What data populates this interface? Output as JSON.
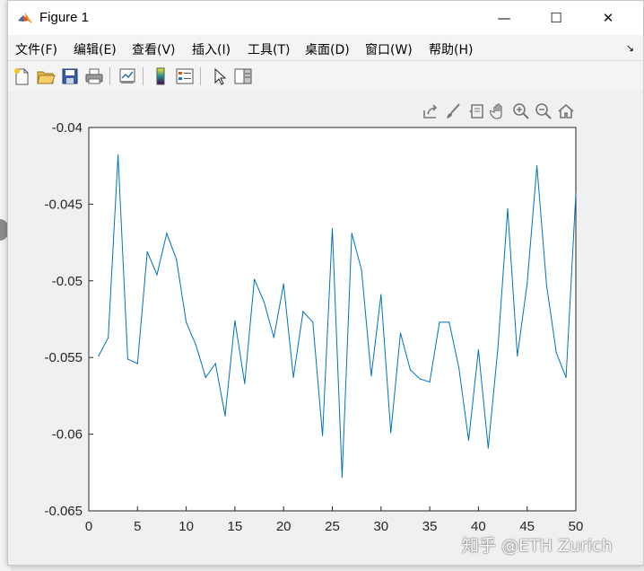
{
  "window": {
    "title": "Figure 1",
    "minimize_glyph": "—",
    "maximize_glyph": "☐",
    "close_glyph": "✕"
  },
  "menu": {
    "items": [
      "文件(F)",
      "编辑(E)",
      "查看(V)",
      "插入(I)",
      "工具(T)",
      "桌面(D)",
      "窗口(W)",
      "帮助(H)"
    ],
    "dock_glyph": "↘"
  },
  "toolbar": {
    "icons": [
      "new-figure-icon",
      "open-file-icon",
      "save-icon",
      "print-icon",
      "link-plot-icon",
      "insert-colorbar-icon",
      "insert-legend-icon",
      "edit-plot-arrow-icon",
      "property-inspector-icon"
    ]
  },
  "axes_toolbar": {
    "icons": [
      "export-icon",
      "brush-icon",
      "data-tips-icon",
      "pan-hand-icon",
      "zoom-in-icon",
      "zoom-out-icon",
      "home-restore-icon"
    ]
  },
  "chart_data": {
    "type": "line",
    "xlim": [
      0,
      50
    ],
    "ylim": [
      -0.065,
      -0.04
    ],
    "xticks": [
      "0",
      "5",
      "10",
      "15",
      "20",
      "25",
      "30",
      "35",
      "40",
      "45",
      "50"
    ],
    "yticks": [
      "-0.04",
      "-0.045",
      "-0.05",
      "-0.055",
      "-0.06",
      "-0.065"
    ],
    "grid": false,
    "color": "#0072BD",
    "x": [
      1,
      2,
      3,
      4,
      5,
      6,
      7,
      8,
      9,
      10,
      11,
      12,
      13,
      14,
      15,
      16,
      17,
      18,
      19,
      20,
      21,
      22,
      23,
      24,
      25,
      26,
      27,
      28,
      29,
      30,
      31,
      32,
      33,
      34,
      35,
      36,
      37,
      38,
      39,
      40,
      41,
      42,
      43,
      44,
      45,
      46,
      47,
      48,
      49,
      50
    ],
    "y": [
      -0.0549,
      -0.0537,
      -0.0418,
      -0.0551,
      -0.0554,
      -0.0481,
      -0.0496,
      -0.0469,
      -0.0486,
      -0.0527,
      -0.0542,
      -0.0563,
      -0.0554,
      -0.0588,
      -0.0526,
      -0.0567,
      -0.0499,
      -0.0514,
      -0.0537,
      -0.0502,
      -0.0563,
      -0.052,
      -0.0527,
      -0.0601,
      -0.0466,
      -0.0628,
      -0.0469,
      -0.0493,
      -0.0562,
      -0.0509,
      -0.0599,
      -0.0534,
      -0.0558,
      -0.0564,
      -0.0566,
      -0.0527,
      -0.0527,
      -0.0557,
      -0.0604,
      -0.0545,
      -0.0609,
      -0.0544,
      -0.0453,
      -0.0549,
      -0.0502,
      -0.0425,
      -0.0503,
      -0.0547,
      -0.0563,
      -0.0443
    ]
  },
  "watermark": "知乎 @ETH Zurich"
}
